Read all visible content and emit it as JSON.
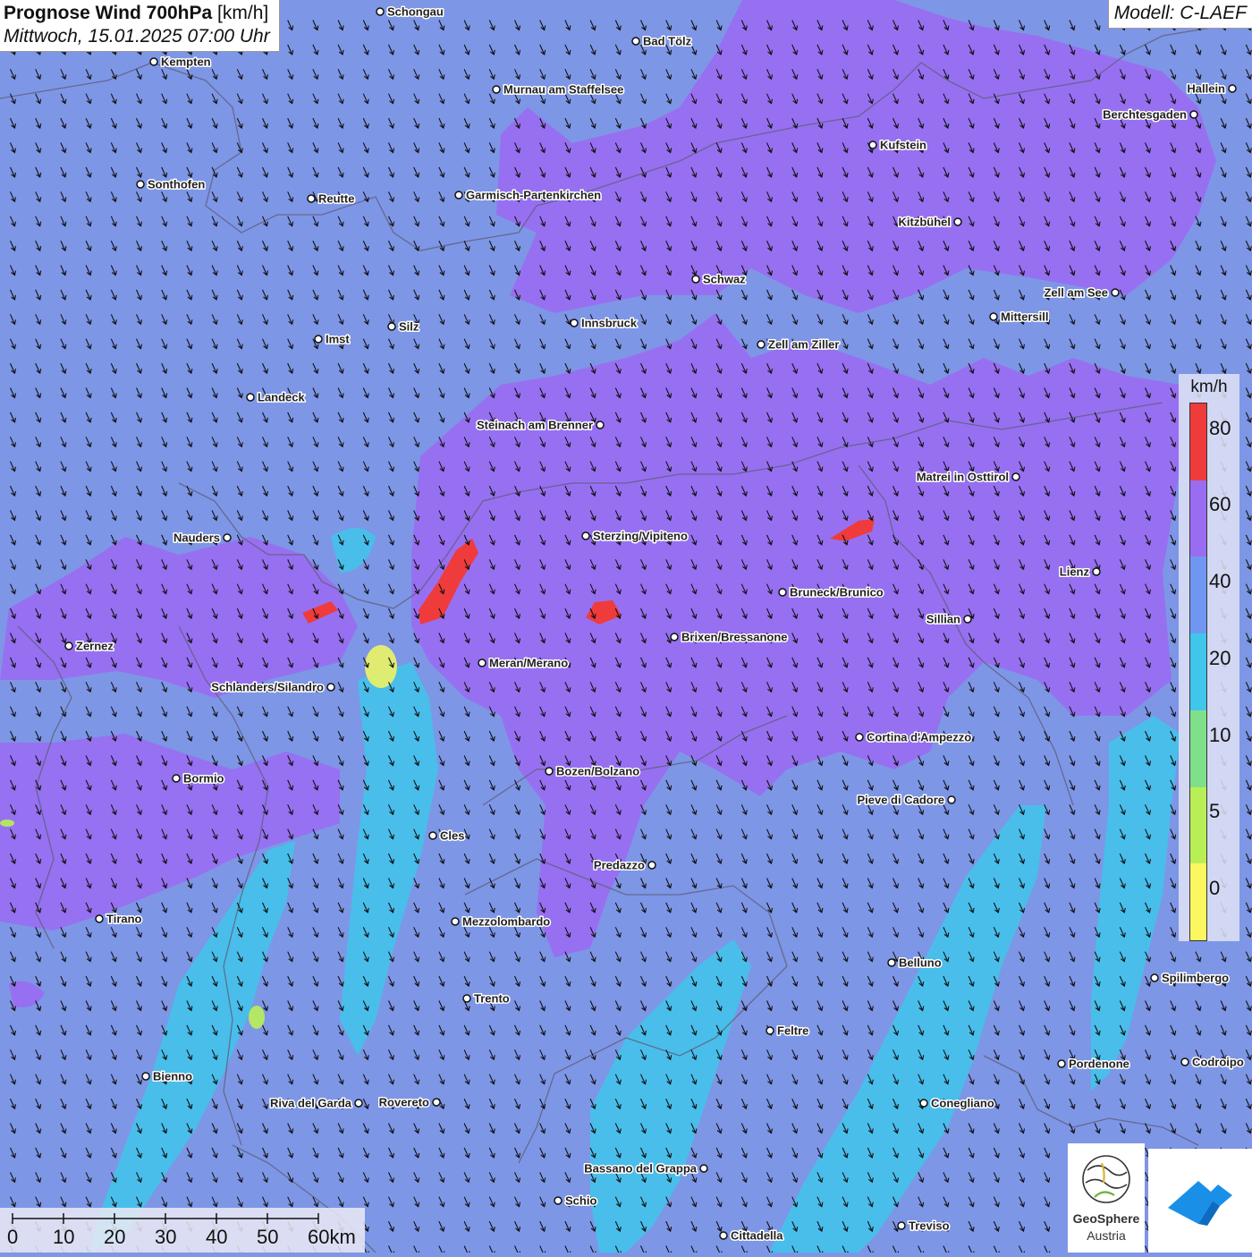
{
  "title": {
    "bold": "Prognose Wind 700hPa",
    "unit": " [km/h]",
    "datetime": "Mittwoch, 15.01.2025 07:00 Uhr"
  },
  "model": "Modell: C-LAEF",
  "legend": {
    "unit": "km/h",
    "ticks": [
      "0",
      "5",
      "10",
      "20",
      "40",
      "60",
      "80"
    ],
    "colors": [
      "#fbf760",
      "#b9ef56",
      "#7fe08c",
      "#3fc6ea",
      "#6f97f2",
      "#9a6cf2",
      "#ef3b3b"
    ]
  },
  "scale": {
    "ticks": [
      "0",
      "10",
      "20",
      "30",
      "40",
      "50",
      "60km"
    ]
  },
  "cities": [
    {
      "name": "Schongau"
    },
    {
      "name": "Bad Tölz"
    },
    {
      "name": "Kempten"
    },
    {
      "name": "Murnau am Staffelsee"
    },
    {
      "name": "Hallein"
    },
    {
      "name": "Berchtesgaden"
    },
    {
      "name": "Kufstein"
    },
    {
      "name": "Sonthofen"
    },
    {
      "name": "Reutte"
    },
    {
      "name": "Garmisch-Partenkirchen"
    },
    {
      "name": "Kitzbühel"
    },
    {
      "name": "Schwaz"
    },
    {
      "name": "Zell am See"
    },
    {
      "name": "Mittersill"
    },
    {
      "name": "Innsbruck"
    },
    {
      "name": "Imst"
    },
    {
      "name": "Silz"
    },
    {
      "name": "Zell am Ziller"
    },
    {
      "name": "Landeck"
    },
    {
      "name": "Steinach am Brenner"
    },
    {
      "name": "Matrei in Osttirol"
    },
    {
      "name": "Nauders"
    },
    {
      "name": "Sterzing/Vipiteno"
    },
    {
      "name": "Lienz"
    },
    {
      "name": "Bruneck/Brunico"
    },
    {
      "name": "Sillian"
    },
    {
      "name": "Zernez"
    },
    {
      "name": "Brixen/Bressanone"
    },
    {
      "name": "Meran/Merano"
    },
    {
      "name": "Schlanders/Silandro"
    },
    {
      "name": "Cortina d'Ampezzo"
    },
    {
      "name": "Bozen/Bolzano"
    },
    {
      "name": "Bormio"
    },
    {
      "name": "Pieve di Cadore"
    },
    {
      "name": "Cles"
    },
    {
      "name": "Predazzo"
    },
    {
      "name": "Tirano"
    },
    {
      "name": "Mezzolombardo"
    },
    {
      "name": "Belluno"
    },
    {
      "name": "Spilimbergo"
    },
    {
      "name": "Trento"
    },
    {
      "name": "Feltre"
    },
    {
      "name": "Bienno"
    },
    {
      "name": "Pordenone"
    },
    {
      "name": "Codroipo"
    },
    {
      "name": "Riva del Garda"
    },
    {
      "name": "Rovereto"
    },
    {
      "name": "Conegliano"
    },
    {
      "name": "Bassano del Grappa"
    },
    {
      "name": "Schio"
    },
    {
      "name": "Treviso"
    },
    {
      "name": "Cittadella"
    }
  ],
  "logo": {
    "name": "GeoSphere",
    "sub": "Austria"
  },
  "colors": {
    "background": "#7e96e6",
    "purple": "#9a6cf2",
    "cyan": "#3fc6ea",
    "red": "#ef3b3b",
    "yellow": "#e6ef6a"
  }
}
